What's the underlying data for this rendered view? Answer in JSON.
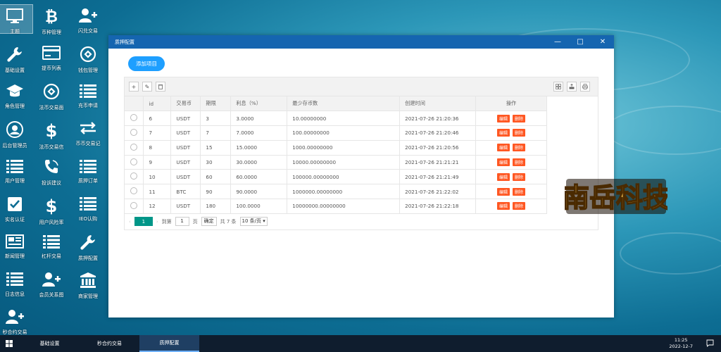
{
  "desktop": {
    "icons": [
      {
        "label": "主题",
        "icon": "monitor-icon"
      },
      {
        "label": "币种管理",
        "icon": "bitcoin-icon"
      },
      {
        "label": "闪兑交易",
        "icon": "user-plus-icon"
      },
      {
        "label": "基础设置",
        "icon": "wrench-icon"
      },
      {
        "label": "提币列表",
        "icon": "card-icon"
      },
      {
        "label": "钱包管理",
        "icon": "exchange-icon"
      },
      {
        "label": "角色管理",
        "icon": "graduation-cap-icon"
      },
      {
        "label": "法币交易面",
        "icon": "exchange-icon"
      },
      {
        "label": "充币申请",
        "icon": "list-icon"
      },
      {
        "label": "后台管理员",
        "icon": "user-circle-icon"
      },
      {
        "label": "法币交易信",
        "icon": "dollar-icon"
      },
      {
        "label": "币币交易记",
        "icon": "arrows-icon"
      },
      {
        "label": "用户管理",
        "icon": "list-icon"
      },
      {
        "label": "投诉建议",
        "icon": "phone-icon"
      },
      {
        "label": "质押订单",
        "icon": "list-icon"
      },
      {
        "label": "实名认证",
        "icon": "check-square-icon"
      },
      {
        "label": "用户风险率",
        "icon": "dollar-icon"
      },
      {
        "label": "IEO认购",
        "icon": "list-icon"
      },
      {
        "label": "新闻管理",
        "icon": "newspaper-icon"
      },
      {
        "label": "杠杆交易",
        "icon": "list-icon"
      },
      {
        "label": "质押配置",
        "icon": "wrench-icon"
      },
      {
        "label": "日志信息",
        "icon": "list-icon"
      },
      {
        "label": "会员关系图",
        "icon": "user-plus-icon"
      },
      {
        "label": "商家管理",
        "icon": "bank-icon"
      },
      {
        "label": "秒合约交易",
        "icon": "user-plus-icon"
      }
    ]
  },
  "window": {
    "title": "质押配置",
    "controls": {
      "minimize": "—",
      "maximize": "□",
      "close": "✕"
    },
    "add_button": "添加项目",
    "toolbar": {
      "add": "+",
      "edit": "✎",
      "delete": "🗑"
    },
    "table": {
      "headers": [
        "",
        "id",
        "交易币",
        "期限",
        "利息（%）",
        "最少存币数",
        "创建时间",
        "操作"
      ],
      "rows": [
        {
          "id": "6",
          "coin": "USDT",
          "term": "3",
          "rate": "3.0000",
          "min": "10.00000000",
          "created": "2021-07-26 21:20:36"
        },
        {
          "id": "7",
          "coin": "USDT",
          "term": "7",
          "rate": "7.0000",
          "min": "100.00000000",
          "created": "2021-07-26 21:20:46"
        },
        {
          "id": "8",
          "coin": "USDT",
          "term": "15",
          "rate": "15.0000",
          "min": "1000.00000000",
          "created": "2021-07-26 21:20:56"
        },
        {
          "id": "9",
          "coin": "USDT",
          "term": "30",
          "rate": "30.0000",
          "min": "10000.00000000",
          "created": "2021-07-26 21:21:21"
        },
        {
          "id": "10",
          "coin": "USDT",
          "term": "60",
          "rate": "60.0000",
          "min": "100000.00000000",
          "created": "2021-07-26 21:21:49"
        },
        {
          "id": "11",
          "coin": "BTC",
          "term": "90",
          "rate": "90.0000",
          "min": "1000000.00000000",
          "created": "2021-07-26 21:22:02"
        },
        {
          "id": "12",
          "coin": "USDT",
          "term": "180",
          "rate": "100.0000",
          "min": "10000000.00000000",
          "created": "2021-07-26 21:22:18"
        }
      ],
      "edit_label": "编辑",
      "delete_label": "删除"
    },
    "pager": {
      "prev": "‹",
      "current": "1",
      "next": "›",
      "goto_label": "到第",
      "page_value": "1",
      "page_unit": "页",
      "confirm": "确定",
      "total": "共 7 条",
      "page_size": "10 条/页"
    }
  },
  "taskbar": {
    "start_icon": "windows-icon",
    "tasks": [
      "基础设置",
      "秒合约交易",
      "质押配置"
    ],
    "active_task": "质押配置",
    "time": "11:25",
    "date": "2022-12-7"
  },
  "logo_text": "南岳科技"
}
